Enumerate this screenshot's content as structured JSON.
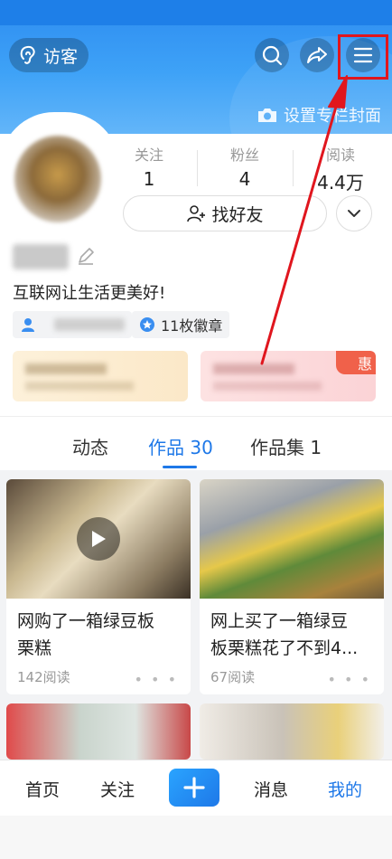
{
  "header": {
    "visitor_label": "访客",
    "cover_label": "设置专栏封面",
    "icons": [
      "ear-icon",
      "search-icon",
      "share-icon",
      "menu-icon",
      "camera-icon"
    ]
  },
  "profile": {
    "stats": [
      {
        "label": "关注",
        "value": "1"
      },
      {
        "label": "粉丝",
        "value": "4"
      },
      {
        "label": "阅读",
        "value": "4.4万"
      }
    ],
    "find_friends_label": "找好友",
    "bio": "互联网让生活更美好!",
    "badges_label": "11枚徽章",
    "promo_badge": "惠"
  },
  "tabs": [
    {
      "label": "动态",
      "active": false
    },
    {
      "label": "作品 30",
      "active": true
    },
    {
      "label": "作品集 1",
      "active": false
    }
  ],
  "feed": [
    {
      "title": "网购了一箱绿豆板栗糕",
      "title_line1": "网购了一箱绿豆板",
      "title_line2": "栗糕",
      "meta": "142阅读"
    },
    {
      "title": "网上买了一箱绿豆板栗糕花了不到4...",
      "title_line1": "网上买了一箱绿豆",
      "title_line2": "板栗糕花了不到4...",
      "meta": "67阅读"
    }
  ],
  "bottom_nav": [
    {
      "label": "首页",
      "active": false
    },
    {
      "label": "关注",
      "active": false
    },
    {
      "label": "消息",
      "active": false
    },
    {
      "label": "我的",
      "active": true
    }
  ],
  "colors": {
    "accent": "#1e78e8",
    "highlight": "#e0161e",
    "header": "#2d8cf0"
  }
}
